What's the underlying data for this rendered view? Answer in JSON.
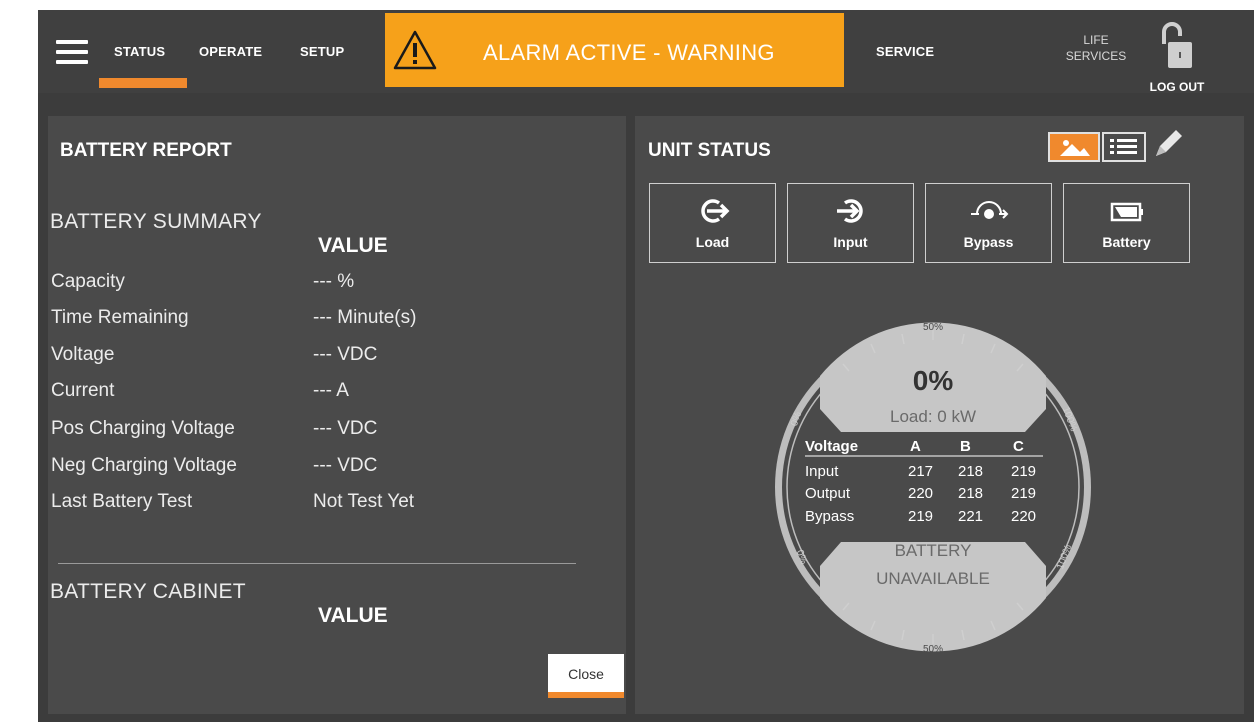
{
  "nav": {
    "status": "STATUS",
    "operate": "OPERATE",
    "setup": "SETUP",
    "service": "SERVICE",
    "life_services_line1": "LIFE",
    "life_services_line2": "SERVICES",
    "logout": "LOG OUT",
    "active_tab": "STATUS"
  },
  "alarm": {
    "text": "ALARM ACTIVE - WARNING",
    "color": "#f6a11a"
  },
  "colors": {
    "accent": "#f0892d",
    "panel": "#4a4a4a",
    "background": "#3c3c3c"
  },
  "battery_report": {
    "title": "BATTERY REPORT",
    "summary": {
      "title": "BATTERY SUMMARY",
      "value_header": "VALUE",
      "rows": [
        {
          "label": "Capacity",
          "value": "--- %"
        },
        {
          "label": "Time Remaining",
          "value": "--- Minute(s)"
        },
        {
          "label": "Voltage",
          "value": "--- VDC"
        },
        {
          "label": "Current",
          "value": "--- A"
        },
        {
          "label": "Pos Charging Voltage",
          "value": "--- VDC"
        },
        {
          "label": "Neg Charging Voltage",
          "value": "--- VDC"
        },
        {
          "label": "Last Battery Test",
          "value": "Not Test Yet"
        }
      ]
    },
    "cabinet": {
      "title": "BATTERY CABINET",
      "value_header": "VALUE"
    },
    "close_label": "Close"
  },
  "unit_status": {
    "title": "UNIT STATUS",
    "view_modes": [
      "graphic-view-icon",
      "list-view-icon"
    ],
    "active_view": "graphic-view-icon",
    "buttons": [
      {
        "label": "Load",
        "icon": "load-icon"
      },
      {
        "label": "Input",
        "icon": "input-icon"
      },
      {
        "label": "Bypass",
        "icon": "bypass-icon"
      },
      {
        "label": "Battery",
        "icon": "battery-icon"
      }
    ],
    "gauge": {
      "load_percent": "0%",
      "load_text": "Load: 0 kW",
      "tick_top": "50%",
      "tick_bottom": "50%",
      "tick_left_top": "0%",
      "tick_right_top": "100%",
      "tick_left_bottom": "0%",
      "tick_right_bottom": "100%",
      "voltage_table": {
        "headers": [
          "Voltage",
          "A",
          "B",
          "C"
        ],
        "rows": [
          {
            "name": "Input",
            "a": "217",
            "b": "218",
            "c": "219"
          },
          {
            "name": "Output",
            "a": "220",
            "b": "218",
            "c": "219"
          },
          {
            "name": "Bypass",
            "a": "219",
            "b": "221",
            "c": "220"
          }
        ]
      },
      "battery_line1": "BATTERY",
      "battery_line2": "UNAVAILABLE"
    }
  }
}
